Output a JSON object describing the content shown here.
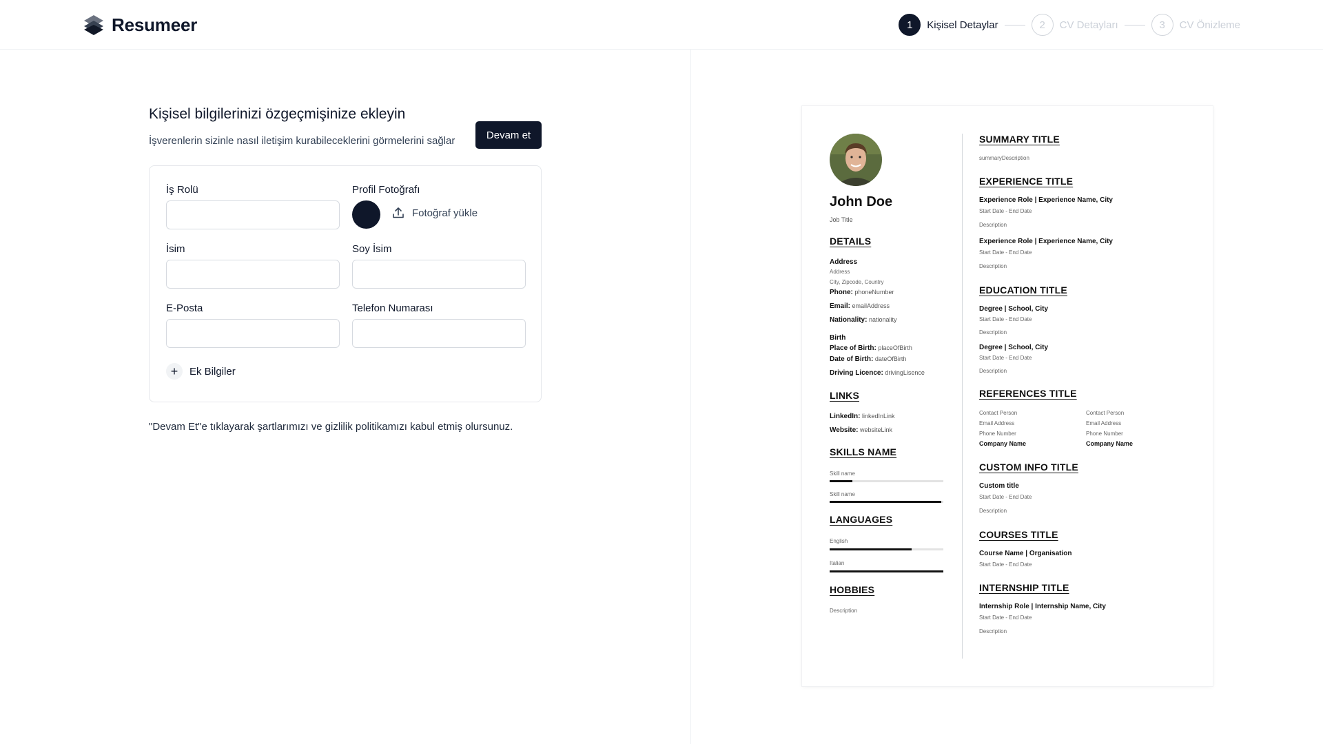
{
  "app": {
    "name": "Resumeer"
  },
  "stepper": [
    {
      "number": "1",
      "label": "Kişisel Detaylar",
      "active": true
    },
    {
      "number": "2",
      "label": "CV Detayları",
      "active": false
    },
    {
      "number": "3",
      "label": "CV Önizleme",
      "active": false
    }
  ],
  "form": {
    "title": "Kişisel bilgilerinizi özgeçmişinize ekleyin",
    "subtitle": "İşverenlerin sizinle nasıl iletişim kurabileceklerini görmelerini sağlar",
    "continue_label": "Devam et",
    "job_role_label": "İş Rolü",
    "job_role_value": "",
    "photo_label": "Profil Fotoğrafı",
    "upload_label": "Fotoğraf yükle",
    "first_name_label": "İsim",
    "first_name_value": "",
    "last_name_label": "Soy İsim",
    "last_name_value": "",
    "email_label": "E-Posta",
    "email_value": "",
    "phone_label": "Telefon Numarası",
    "phone_value": "",
    "extra_label": "Ek Bilgiler",
    "terms": "\"Devam Et\"e tıklayarak şartlarımızı ve gizlilik politikamızı kabul etmiş olursunuz."
  },
  "resume": {
    "name": "John Doe",
    "job_title": "Job Title",
    "details": {
      "heading": "DETAILS",
      "address_label": "Address",
      "address": "Address",
      "city_line": "City, Zipcode, Country",
      "phone_label": "Phone:",
      "phone": "phoneNumber",
      "email_label": "Email:",
      "email": "emailAddress",
      "nationality_label": "Nationality:",
      "nationality": "nationality",
      "birth_label": "Birth",
      "place_label": "Place of Birth:",
      "place": "placeOfBirth",
      "date_label": "Date of Birth:",
      "date": "dateOfBirth",
      "licence_label": "Driving Licence:",
      "licence": "drivingLisence"
    },
    "links": {
      "heading": "LINKS",
      "linkedin_label": "LinkedIn:",
      "linkedin": "linkedInLink",
      "website_label": "Website:",
      "website": "websiteLink"
    },
    "skills": {
      "heading": "SKILLS NAME",
      "items": [
        {
          "name": "Skill name",
          "level": 0.2
        },
        {
          "name": "Skill name",
          "level": 0.98
        }
      ]
    },
    "languages": {
      "heading": "LANGUAGES",
      "items": [
        {
          "name": "English",
          "level": 0.72
        },
        {
          "name": "Italian",
          "level": 1.0
        }
      ]
    },
    "hobbies": {
      "heading": "HOBBIES",
      "description": "Description"
    },
    "summary": {
      "heading": "SUMMARY TITLE",
      "description": "summaryDescription"
    },
    "experience": {
      "heading": "EXPERIENCE TITLE",
      "items": [
        {
          "title": "Experience Role | Experience Name, City",
          "dates": "Start Date - End Date",
          "description": "Description"
        },
        {
          "title": "Experience Role | Experience Name, City",
          "dates": "Start Date - End Date",
          "description": "Description"
        }
      ]
    },
    "education": {
      "heading": "EDUCATION TITLE",
      "items": [
        {
          "title": "Degree | School, City",
          "dates": "Start Date - End Date",
          "description": "Description"
        },
        {
          "title": "Degree | School, City",
          "dates": "Start Date - End Date",
          "description": "Description"
        }
      ]
    },
    "references": {
      "heading": "REFERENCES TITLE",
      "items": [
        {
          "person": "Contact Person",
          "email": "Email Address",
          "phone": "Phone Number",
          "company": "Company Name"
        },
        {
          "person": "Contact Person",
          "email": "Email Address",
          "phone": "Phone Number",
          "company": "Company Name"
        }
      ]
    },
    "custom": {
      "heading": "CUSTOM INFO TITLE",
      "title": "Custom title",
      "dates": "Start Date - End Date",
      "description": "Description"
    },
    "courses": {
      "heading": "COURSES TITLE",
      "title": "Course Name | Organisation",
      "dates": "Start Date - End Date"
    },
    "internship": {
      "heading": "INTERNSHIP TITLE",
      "title": "Internship Role | Internship Name, City",
      "dates": "Start Date - End Date",
      "description": "Description"
    }
  }
}
